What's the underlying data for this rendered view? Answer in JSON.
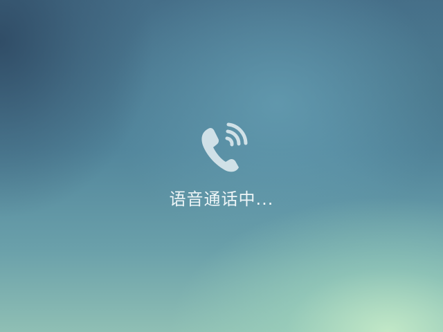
{
  "call": {
    "status_text": "语音通话中...",
    "icon": "phone-ringing-icon"
  }
}
